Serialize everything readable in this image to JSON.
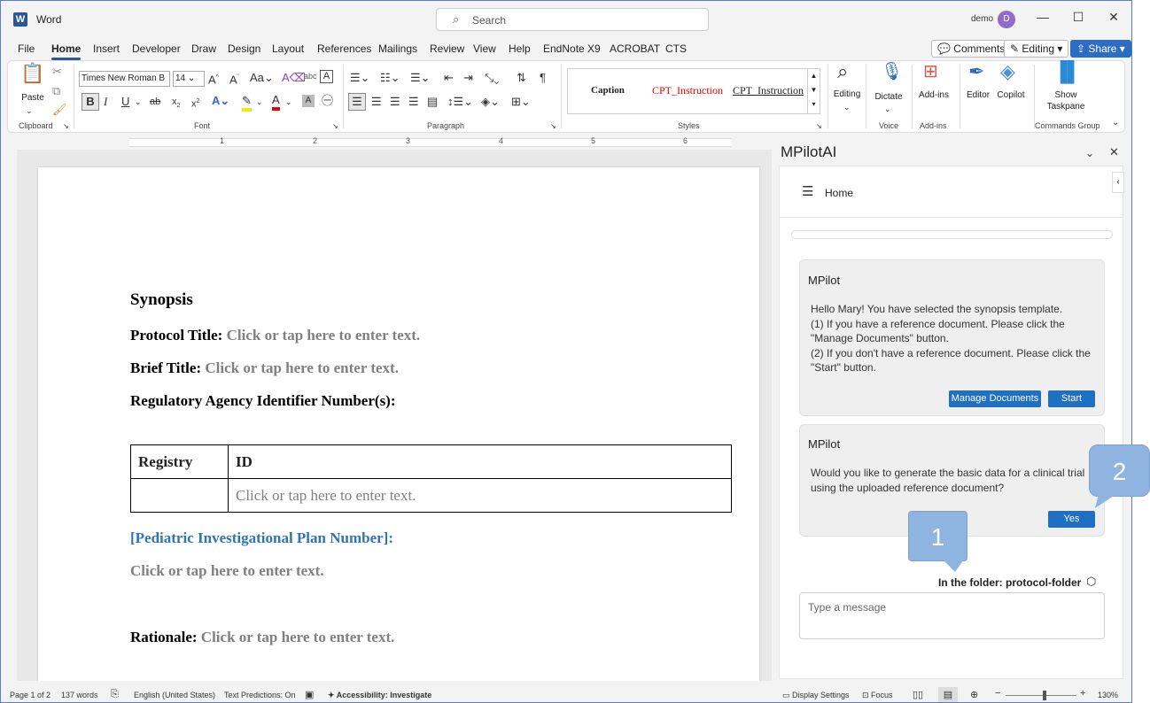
{
  "app": {
    "name": "Word",
    "logo_letter": "W"
  },
  "search": {
    "placeholder": "Search"
  },
  "user": {
    "name": "demo",
    "initial": "D"
  },
  "tabs": [
    "File",
    "Home",
    "Insert",
    "Developer",
    "Draw",
    "Design",
    "Layout",
    "References",
    "Mailings",
    "Review",
    "View",
    "Help",
    "EndNote X9",
    "ACROBAT",
    "CTS"
  ],
  "header_buttons": {
    "comments": "Comments",
    "editing": "Editing",
    "share": "Share"
  },
  "ribbon": {
    "clipboard": {
      "paste": "Paste",
      "label": "Clipboard"
    },
    "font": {
      "family": "Times New Roman B",
      "size": "14",
      "label": "Font"
    },
    "paragraph": {
      "label": "Paragraph"
    },
    "styles": {
      "items": [
        "Caption",
        "CPT_Instruction",
        "CPT_Instruction"
      ],
      "label": "Styles"
    },
    "editing": {
      "label": "Editing"
    },
    "voice": {
      "dictate": "Dictate",
      "label": "Voice"
    },
    "addins": {
      "addins": "Add-ins",
      "label": "Add-ins"
    },
    "editor": "Editor",
    "copilot": "Copilot",
    "commands": {
      "show_taskpane_1": "Show",
      "show_taskpane_2": "Taskpane",
      "label": "Commands Group"
    }
  },
  "ruler_numbers": [
    "1",
    "2",
    "3",
    "4",
    "5",
    "6"
  ],
  "document": {
    "heading": "Synopsis",
    "protocol_title_label": "Protocol Title:",
    "brief_title_label": "Brief Title:",
    "placeholder": "Click or tap here to enter text.",
    "regulatory_label": "Regulatory Agency Identifier Number(s):",
    "table": {
      "headers": [
        "Registry",
        "ID"
      ],
      "row_placeholder": "Click or tap here to enter text."
    },
    "pip_label": "[Pediatric Investigational Plan Number]:",
    "rationale_label": "Rationale:"
  },
  "pane": {
    "title": "MPilotAI",
    "home": "Home",
    "card1": {
      "title": "MPilot",
      "lines": [
        "Hello Mary! You have selected the synopsis template.",
        "(1) If you have a reference document. Please click the",
        "\"Manage Documents\" button.",
        "(2) If you don't have a reference document. Please click the",
        "\"Start\" button."
      ],
      "btn_manage": "Manage Documents",
      "btn_start": "Start"
    },
    "card2": {
      "title": "MPilot",
      "lines": [
        "Would you like to generate the basic data for a clinical trial",
        "using the uploaded reference document?"
      ],
      "btn_yes": "Yes"
    },
    "folder": "In the folder: protocol-folder",
    "message_placeholder": "Type a message"
  },
  "callouts": [
    "1",
    "2"
  ],
  "status": {
    "page": "Page 1 of 2",
    "words": "137 words",
    "language": "English (United States)",
    "predictions": "Text Predictions: On",
    "accessibility": "Accessibility: Investigate",
    "display": "Display Settings",
    "focus": "Focus",
    "zoom": "130%"
  },
  "colors": {
    "accent": "#2b579a",
    "button_blue": "#1f6fc5",
    "callout": "#8fb4df",
    "link_blue": "#2e75b6"
  }
}
